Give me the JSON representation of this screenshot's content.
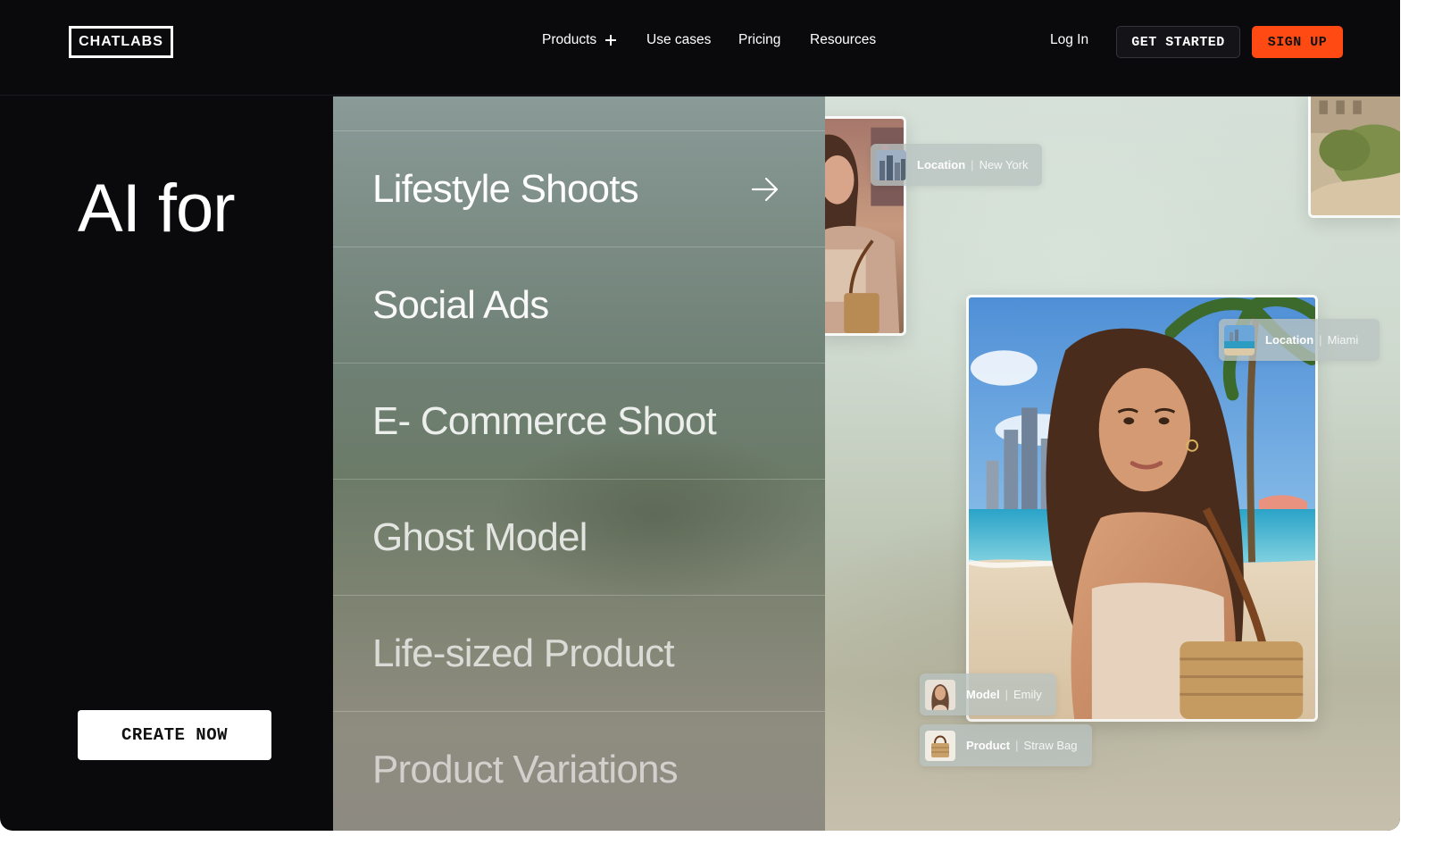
{
  "header": {
    "logo": "CHATLABS",
    "nav": [
      {
        "label": "Products",
        "has_plus": true
      },
      {
        "label": "Use cases"
      },
      {
        "label": "Pricing"
      },
      {
        "label": "Resources"
      }
    ],
    "login": "Log In",
    "get_started": "GET STARTED",
    "sign_up": "SIGN UP"
  },
  "hero": {
    "title": "AI for",
    "cta": "CREATE NOW"
  },
  "menu": {
    "items": [
      {
        "label": "Lifestyle Shoots",
        "active": true,
        "icon": "arrow-right-icon"
      },
      {
        "label": "Social Ads"
      },
      {
        "label": "E- Commerce Shoot"
      },
      {
        "label": "Ghost Model"
      },
      {
        "label": "Life-sized Product"
      },
      {
        "label": "Product Variations"
      }
    ]
  },
  "showcase": {
    "tags": {
      "location_ny": {
        "key": "Location",
        "value": "New York"
      },
      "location_miami": {
        "key": "Location",
        "value": "Miami"
      },
      "model": {
        "key": "Model",
        "value": "Emily"
      },
      "product": {
        "key": "Product",
        "value": "Straw Bag"
      }
    }
  },
  "colors": {
    "background": "#0a0a0c",
    "accent": "#ff4a14",
    "text": "#ffffff"
  }
}
